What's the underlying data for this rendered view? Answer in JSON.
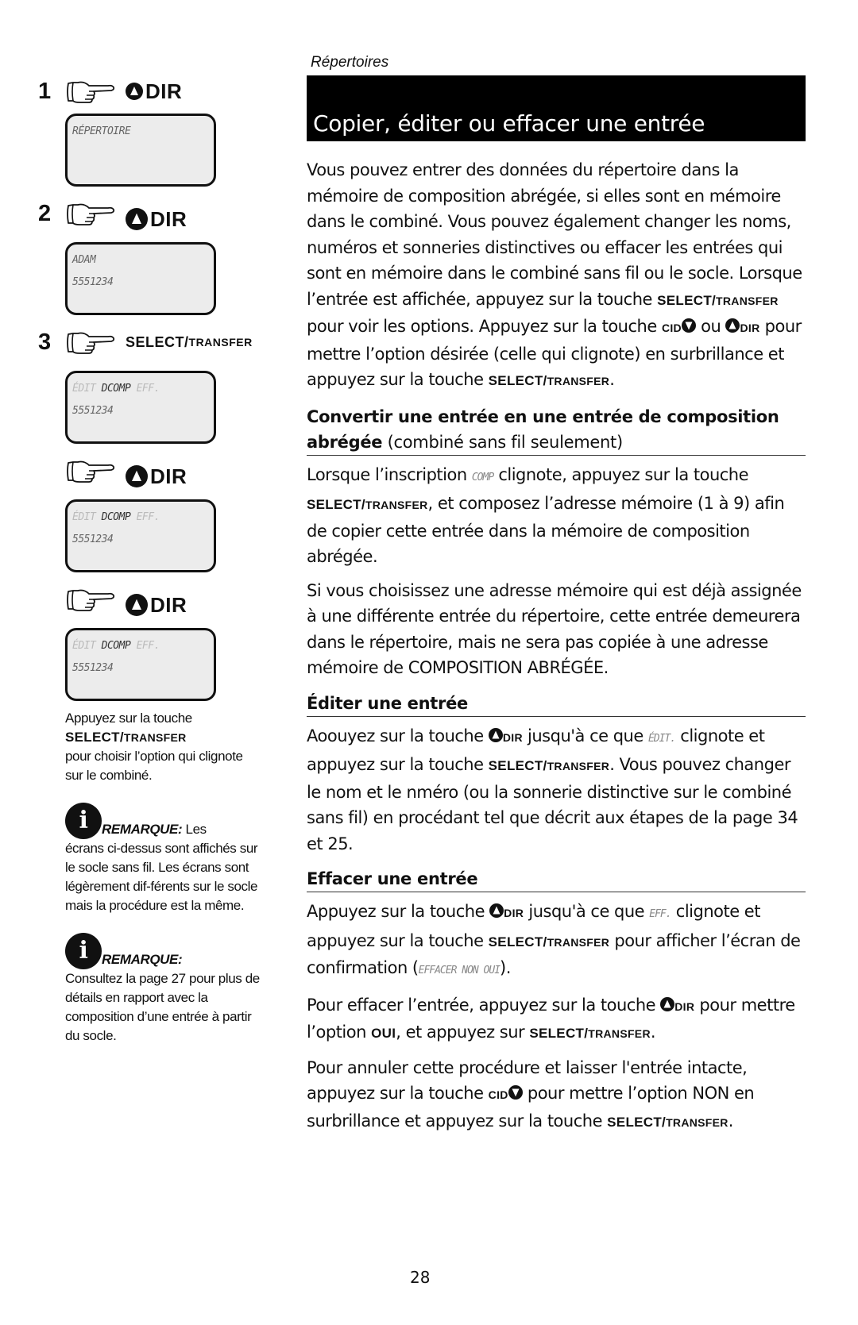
{
  "left": {
    "steps": [
      {
        "num": "1",
        "key_icon": "up-arrow-dir",
        "key_label": "DIR",
        "lcd_lines": [
          "RÉPERTOIRE"
        ]
      },
      {
        "num": "2",
        "key_icon": "up-arrow-dir",
        "key_label": "DIR",
        "lcd_lines": [
          "ADAM",
          "5551234"
        ]
      },
      {
        "num": "3",
        "key_label_main": "SELECT/",
        "key_label_small": "TRANSFER",
        "lcd_options": {
          "edit": "ÉDIT",
          "comp": "DCOMP",
          "del": "EFF."
        },
        "lcd_line2": "5551234"
      },
      {
        "num": "",
        "key_icon": "up-arrow-dir",
        "key_label": "DIR",
        "lcd_options": {
          "edit": "ÉDIT",
          "comp": "DCOMP",
          "del": "EFF."
        },
        "lcd_line2": "5551234"
      },
      {
        "num": "",
        "key_icon": "up-arrow-dir",
        "key_label": "DIR",
        "lcd_options": {
          "edit": "ÉDIT",
          "comp": "DCOMP",
          "del": "EFF."
        },
        "lcd_line2": "5551234"
      }
    ],
    "caption": {
      "line1": "Appuyez sur la touche",
      "key_main": "SELECT/",
      "key_small": "TRANSFER",
      "line2": "pour choisir l’option qui clignote sur le combiné."
    },
    "notes": [
      {
        "label": "REMARQUE:",
        "text_inline": " Les",
        "text": "écrans ci-dessus sont affichés sur le socle sans fil.  Les écrans sont légèrement dif-férents sur le socle mais la procédure est la même."
      },
      {
        "label": "REMARQUE:",
        "text_inline": "",
        "text": "Consultez la page 27 pour plus de détails en rapport avec la composition d’une entrée à partir du socle."
      }
    ]
  },
  "header": {
    "section": "Répertoires",
    "title": "Copier, éditer ou effacer une entrée"
  },
  "keys": {
    "select_main": "SELECT/",
    "select_small": "TRANSFER",
    "cid": "CID",
    "dir": "DIR",
    "oui": "OUI"
  },
  "intro": {
    "t1": "Vous pouvez entrer des données du répertoire dans la mémoire de composition abrégée, si elles sont en mémoire dans le combiné. Vous pouvez également changer les noms, numéros et sonneries distinctives ou effacer les entrées qui sont en mémoire dans le combiné sans fil ou le socle.  Lorsque l’entrée est affichée, appuyez sur la touche ",
    "t2": " pour voir les options. Appuyez sur la touche ",
    "t3": " ou ",
    "t4": " pour mettre l’option désirée (celle qui clignote) en surbrillance et appuyez sur la touche ",
    "t5": "."
  },
  "convert": {
    "heading_bold": "Convertir une entrée en une entrée de composition abrégée",
    "heading_normal": " (combiné sans fil seulement)",
    "p1_a": "Lorsque l’inscription ",
    "p1_lcd": "COMP",
    "p1_b": " clignote, appuyez sur la touche ",
    "p1_c": ", et composez l’adresse mémoire (1 à 9) afin de copier cette entrée dans la mémoire de composition abrégée.",
    "p2": "Si vous choisissez une adresse mémoire qui est déjà assignée à une différente entrée du répertoire, cette entrée demeurera dans le répertoire, mais ne sera pas copiée à une adresse mémoire de COMPOSITION ABRÉGÉE."
  },
  "edit": {
    "heading": "Éditer une entrée",
    "a": "Aoouyez sur la touche ",
    "b": " jusqu'à ce que ",
    "lcd": "ÉDIT.",
    "c": " clignote et appuyez sur la touche ",
    "d": ". Vous pouvez changer le nom et le nméro (ou la sonnerie distinctive sur le combiné sans fil) en procédant tel que décrit aux étapes de la page 34 et 25."
  },
  "delete": {
    "heading": "Effacer une entrée",
    "p1_a": "Appuyez sur la touche ",
    "p1_b": " jusqu'à ce que ",
    "p1_lcd": "EFF.",
    "p1_c": " clignote et appuyez sur la touche ",
    "p1_d": " pour afficher l’écran de confirmation (",
    "p1_lcd2": "EFFACER NON OUI",
    "p1_e": ").",
    "p2_a": "Pour effacer l’entrée, appuyez sur la touche ",
    "p2_b": " pour mettre l’option ",
    "p2_c": ", et appuyez sur  ",
    "p2_d": ".",
    "p3_a": "Pour annuler cette procédure et laisser l'entrée intacte, appuyez sur la touche ",
    "p3_b": "  pour mettre l’option NON en surbrillance et appuyez sur la touche ",
    "p3_c": "."
  },
  "footer": {
    "page_number": "28"
  }
}
